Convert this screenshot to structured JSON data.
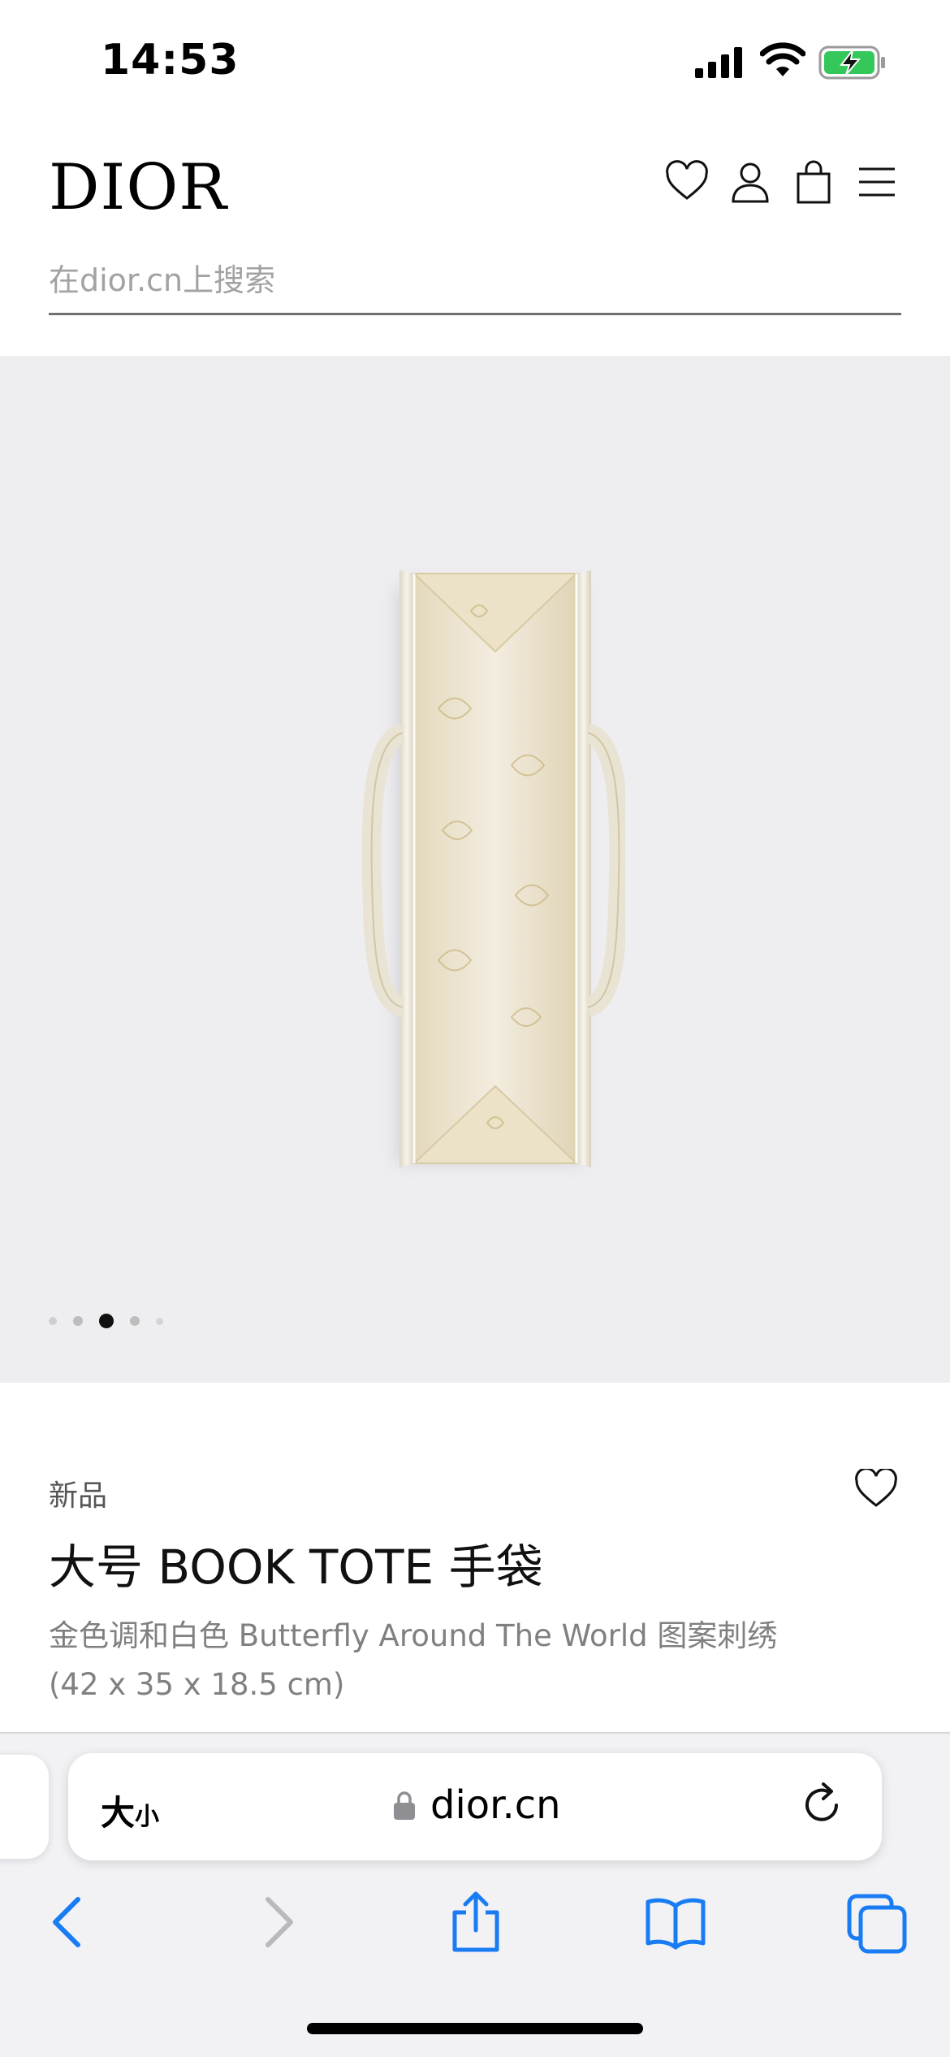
{
  "status_bar": {
    "time": "14:53"
  },
  "header": {
    "logo": "DIOR",
    "search_placeholder": "在dior.cn上搜索",
    "icons": [
      "heart-icon",
      "account-icon",
      "shopping-bag-icon",
      "menu-icon"
    ]
  },
  "gallery": {
    "slide_count": 5,
    "active_slide": 3
  },
  "product": {
    "badge": "新品",
    "title": "大号 BOOK TOTE 手袋",
    "description_line1": "金色调和白色 Butterfly Around The World 图案刺绣",
    "description_line2": "(42 x 35 x 18.5 cm)"
  },
  "browser": {
    "text_size_big": "大",
    "text_size_small": "小",
    "url": "dior.cn",
    "toolbar": [
      "back-icon",
      "forward-icon",
      "share-icon",
      "bookmarks-icon",
      "tabs-icon"
    ]
  },
  "colors": {
    "hero_background": "#eeedf0",
    "browser_blue": "#1a7cf3",
    "battery_green": "#34c759"
  }
}
